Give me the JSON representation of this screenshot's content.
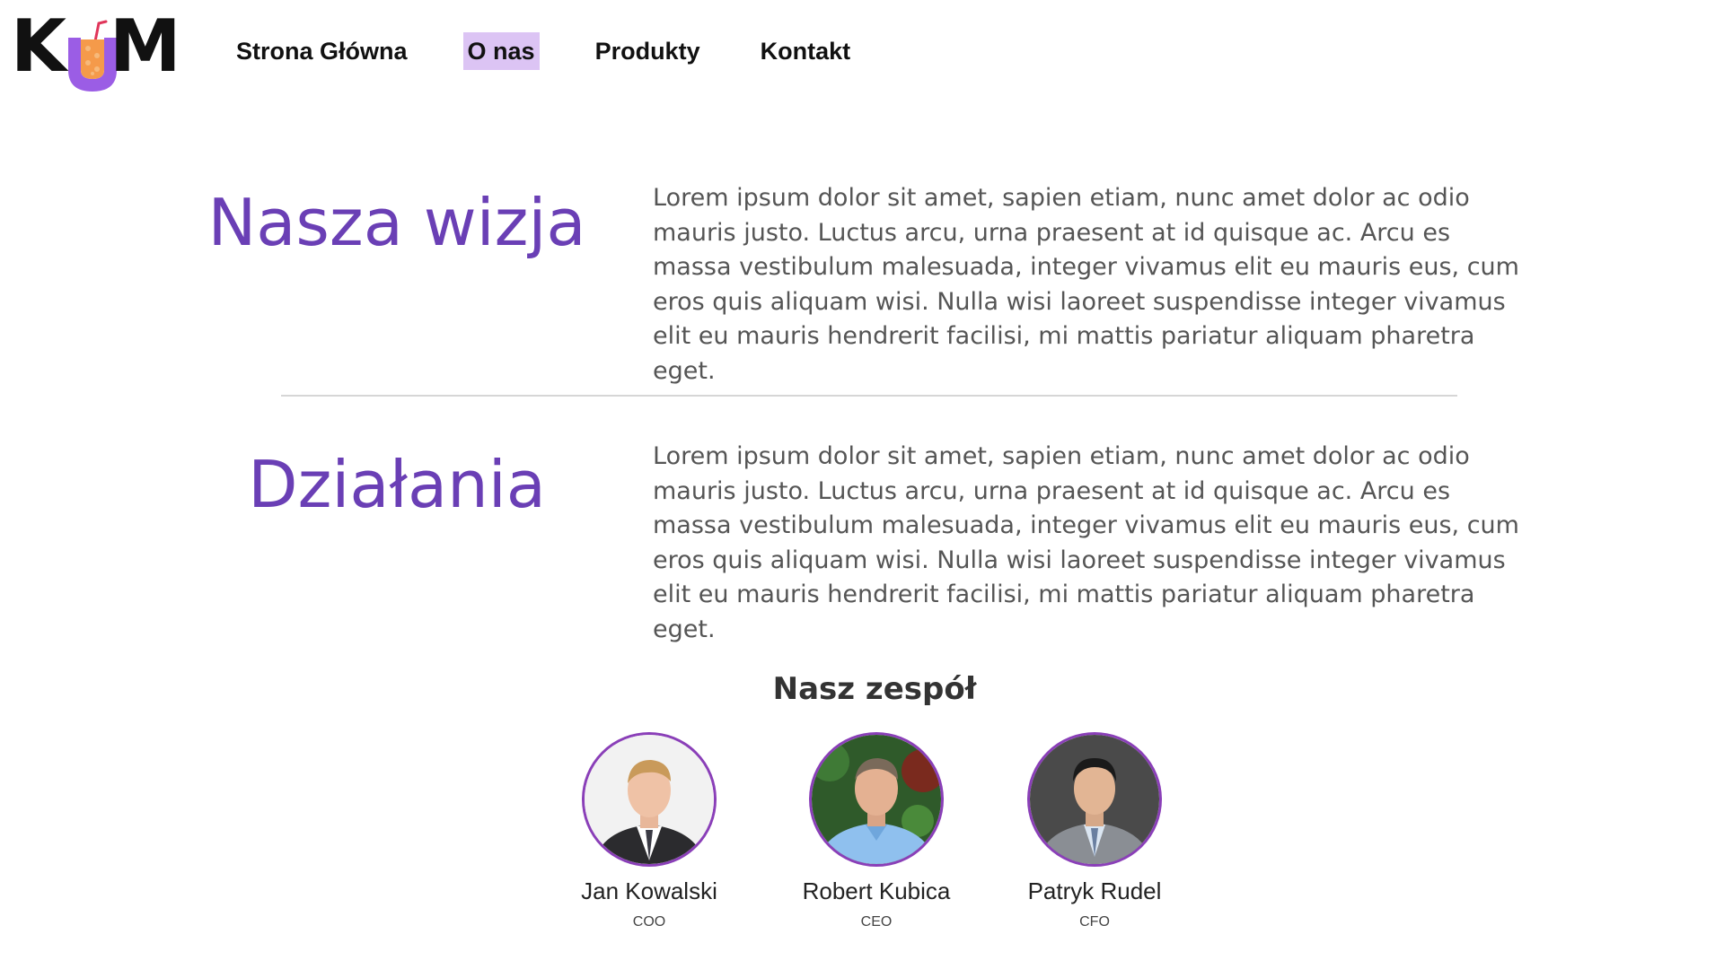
{
  "brand": {
    "logo_text": "KUM",
    "logo_k": "K",
    "logo_m": "M"
  },
  "nav": {
    "items": [
      {
        "label": "Strona Główna"
      },
      {
        "label": "O nas"
      },
      {
        "label": "Produkty"
      },
      {
        "label": "Kontakt"
      }
    ]
  },
  "vision": {
    "title": "Nasza wizja",
    "text": "Lorem ipsum dolor sit amet, sapien etiam, nunc amet dolor ac odio mauris justo. Luctus arcu, urna praesent at id quisque ac. Arcu es massa vestibulum malesuada, integer vivamus elit eu mauris eus, cum eros quis aliquam wisi. Nulla wisi laoreet suspendisse integer vivamus elit eu mauris hendrerit facilisi, mi mattis pariatur aliquam pharetra eget."
  },
  "actions": {
    "title": "Działania",
    "text": "Lorem ipsum dolor sit amet, sapien etiam, nunc amet dolor ac odio mauris justo. Luctus arcu, urna praesent at id quisque ac. Arcu es massa vestibulum malesuada, integer vivamus elit eu mauris eus, cum eros quis aliquam wisi. Nulla wisi laoreet suspendisse integer vivamus elit eu mauris hendrerit facilisi, mi mattis pariatur aliquam pharetra eget."
  },
  "team": {
    "title": "Nasz zespół",
    "members": [
      {
        "name": "Jan Kowalski",
        "role": "COO"
      },
      {
        "name": "Robert Kubica",
        "role": "CEO"
      },
      {
        "name": "Patryk Rudel",
        "role": "CFO"
      }
    ]
  },
  "colors": {
    "accent": "#6a3fb5",
    "nav_active_bg": "#dcc4f4",
    "avatar_border": "#8a3fb8",
    "cup_orange": "#f59a4a"
  }
}
